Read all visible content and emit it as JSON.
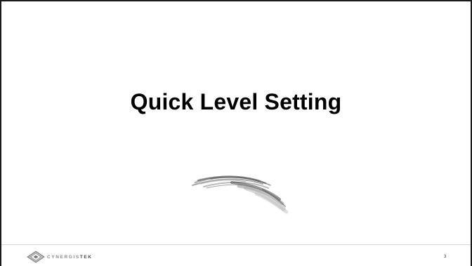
{
  "slide": {
    "title": "Quick Level Setting",
    "page_number": "3"
  },
  "footer": {
    "brand_light": "CYNERGIS",
    "brand_strong": "TEK",
    "logo_icon": "cynergistek-diamond-logo-icon"
  },
  "decoration": {
    "brush_icon": "brush-stroke-icon"
  },
  "colors": {
    "border": "#1a1a1a",
    "title": "#000000",
    "footer_line": "#d4d4d4",
    "brand_gray": "#8a8a8a"
  }
}
